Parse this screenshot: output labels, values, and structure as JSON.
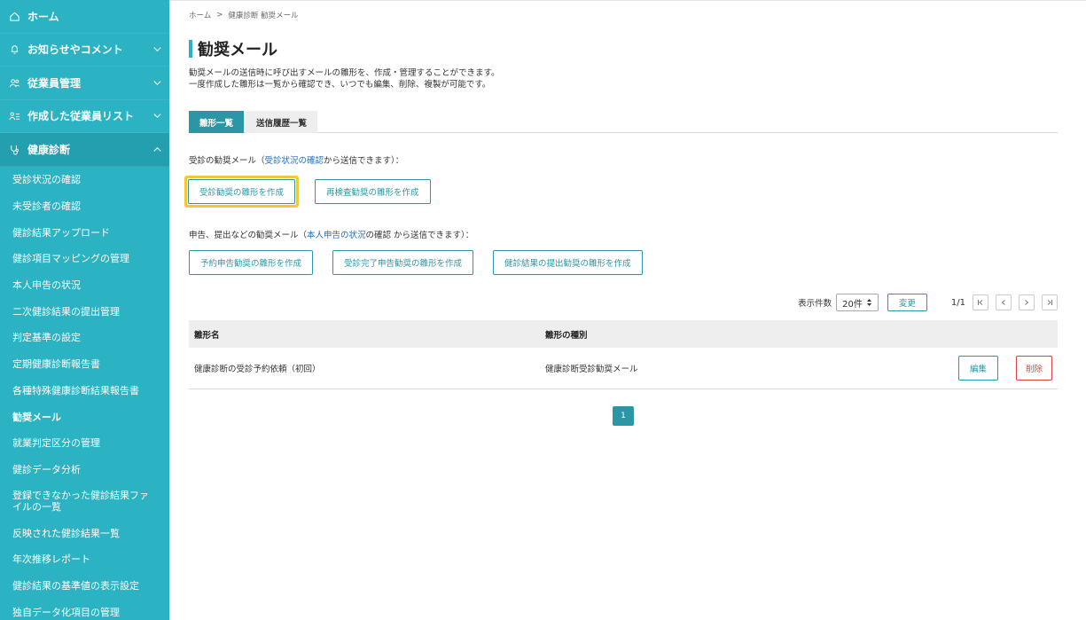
{
  "sidebar": {
    "top": [
      {
        "label": "ホーム",
        "icon": "home-icon"
      },
      {
        "label": "お知らせやコメント",
        "icon": "bell-icon"
      },
      {
        "label": "従業員管理",
        "icon": "users-icon"
      },
      {
        "label": "作成した従業員リスト",
        "icon": "person-list-icon"
      },
      {
        "label": "健康診断",
        "icon": "stethoscope-icon"
      }
    ],
    "sub_items": [
      "受診状況の確認",
      "未受診者の確認",
      "健診結果アップロード",
      "健診項目マッピングの管理",
      "本人申告の状況",
      "二次健診結果の提出管理",
      "判定基準の設定",
      "定期健康診断報告書",
      "各種特殊健康診断結果報告書",
      "勧奨メール",
      "就業判定区分の管理",
      "健診データ分析",
      "登録できなかった健診結果ファイルの一覧",
      "反映された健診結果一覧",
      "年次推移レポート",
      "健診結果の基準値の表示設定",
      "独自データ化項目の管理"
    ]
  },
  "breadcrumb": {
    "home": "ホーム",
    "sep": ">",
    "current": "健康診断 勧奨メール"
  },
  "page": {
    "title": "勧奨メール",
    "desc_line1": "勧奨メールの送信時に呼び出すメールの雛形を、作成・管理することができます。",
    "desc_line2": "一度作成した雛形は一覧から確認でき、いつでも編集、削除、複製が可能です。"
  },
  "tabs": {
    "templates": "雛形一覧",
    "history": "送信履歴一覧"
  },
  "section1": {
    "prefix": "受診の勧奨メール（",
    "link": "受診状況の確認",
    "suffix": "から送信できます）：",
    "btn_create_exam": "受診勧奨の雛形を作成",
    "btn_create_recheck": "再検査勧奨の雛形を作成"
  },
  "section2": {
    "prefix": "申告、提出などの勧奨メール（",
    "link": "本人申告の状況",
    "suffix": "の確認 から送信できます）：",
    "btn_report": "予約申告勧奨の雛形を作成",
    "btn_complete": "受診完了申告勧奨の雛形を作成",
    "btn_submit": "健診結果の提出勧奨の雛形を作成"
  },
  "pager": {
    "label": "表示件数",
    "select_value": "20件",
    "change": "変更",
    "count": "1/1",
    "first": "|<",
    "prev": "<",
    "next": ">",
    "last": ">|"
  },
  "table": {
    "headers": [
      "雛形名",
      "雛形の種別"
    ],
    "rows": [
      {
        "name": "健康診断の受診予約依頼（初回）",
        "type": "健康診断受診勧奨メール",
        "edit": "編集",
        "delete": "削除"
      }
    ]
  },
  "bottom_pager": {
    "current": "1"
  },
  "colors": {
    "accent": "#2bb3c4",
    "accent_dark": "#2b97a6",
    "highlight": "#f4c73a",
    "danger": "#e04040",
    "link": "#1f6fbf"
  }
}
